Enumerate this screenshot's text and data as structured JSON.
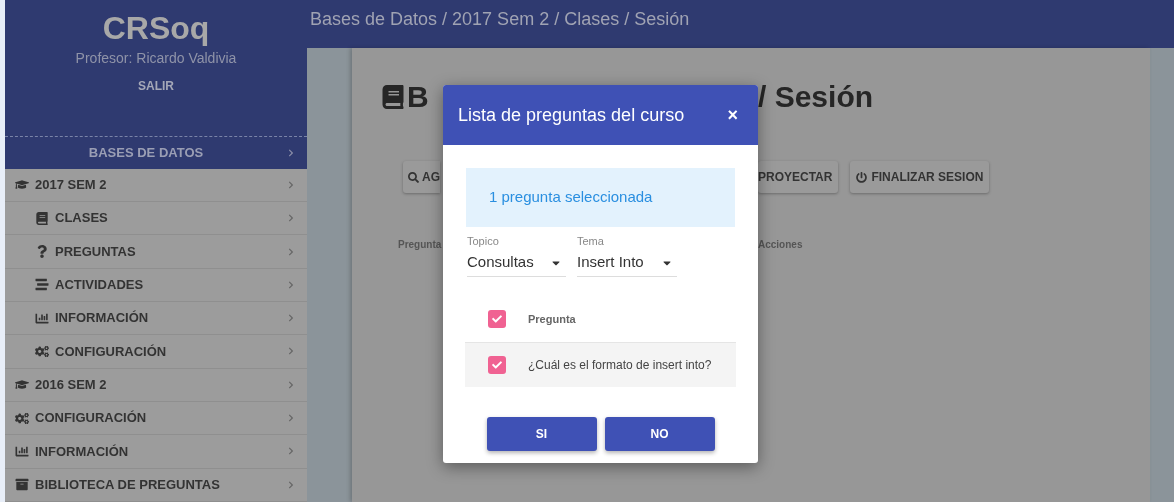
{
  "sidebar": {
    "brand": "CRSoq",
    "subtitle": "Profesor: Ricardo Valdivia",
    "logout": "SALIR",
    "course": "BASES DE DATOS",
    "items": [
      {
        "kind": "semester",
        "label": "2017 SEM 2",
        "children": [
          {
            "kind": "classes",
            "label": "CLASES"
          },
          {
            "kind": "questions",
            "label": "PREGUNTAS"
          },
          {
            "kind": "activities",
            "label": "ACTIVIDADES"
          },
          {
            "kind": "info",
            "label": "INFORMACIÓN"
          },
          {
            "kind": "config",
            "label": "CONFIGURACIÓN"
          }
        ]
      },
      {
        "kind": "semester",
        "label": "2016 SEM 2"
      },
      {
        "kind": "config",
        "label": "CONFIGURACIÓN"
      },
      {
        "kind": "info",
        "label": "INFORMACIÓN"
      },
      {
        "kind": "library",
        "label": "BIBLIOTECA DE PREGUNTAS"
      }
    ]
  },
  "topbar": {
    "breadcrumb": "Bases de Datos / 2017 Sem 2 / Clases / Sesión"
  },
  "page": {
    "title_left": "B",
    "title_right": "/ Sesión",
    "button_left": "AG",
    "buttons_right": [
      {
        "kind": "project",
        "label": "PROYECTAR"
      },
      {
        "kind": "finish",
        "label": "FINALIZAR SESION"
      }
    ],
    "column_left": "Pregunta",
    "column_right": "Acciones"
  },
  "dialog": {
    "title": "Lista de preguntas del curso",
    "close": "×",
    "info": "1 pregunta seleccionada",
    "filters": [
      {
        "label": "Topico",
        "value": "Consultas"
      },
      {
        "label": "Tema",
        "value": "Insert Into"
      }
    ],
    "header": {
      "label": "Pregunta",
      "checked": true
    },
    "rows": [
      {
        "text": "¿Cuál es el formato de insert into?",
        "checked": true
      }
    ],
    "buttons": [
      "SI",
      "NO"
    ]
  }
}
